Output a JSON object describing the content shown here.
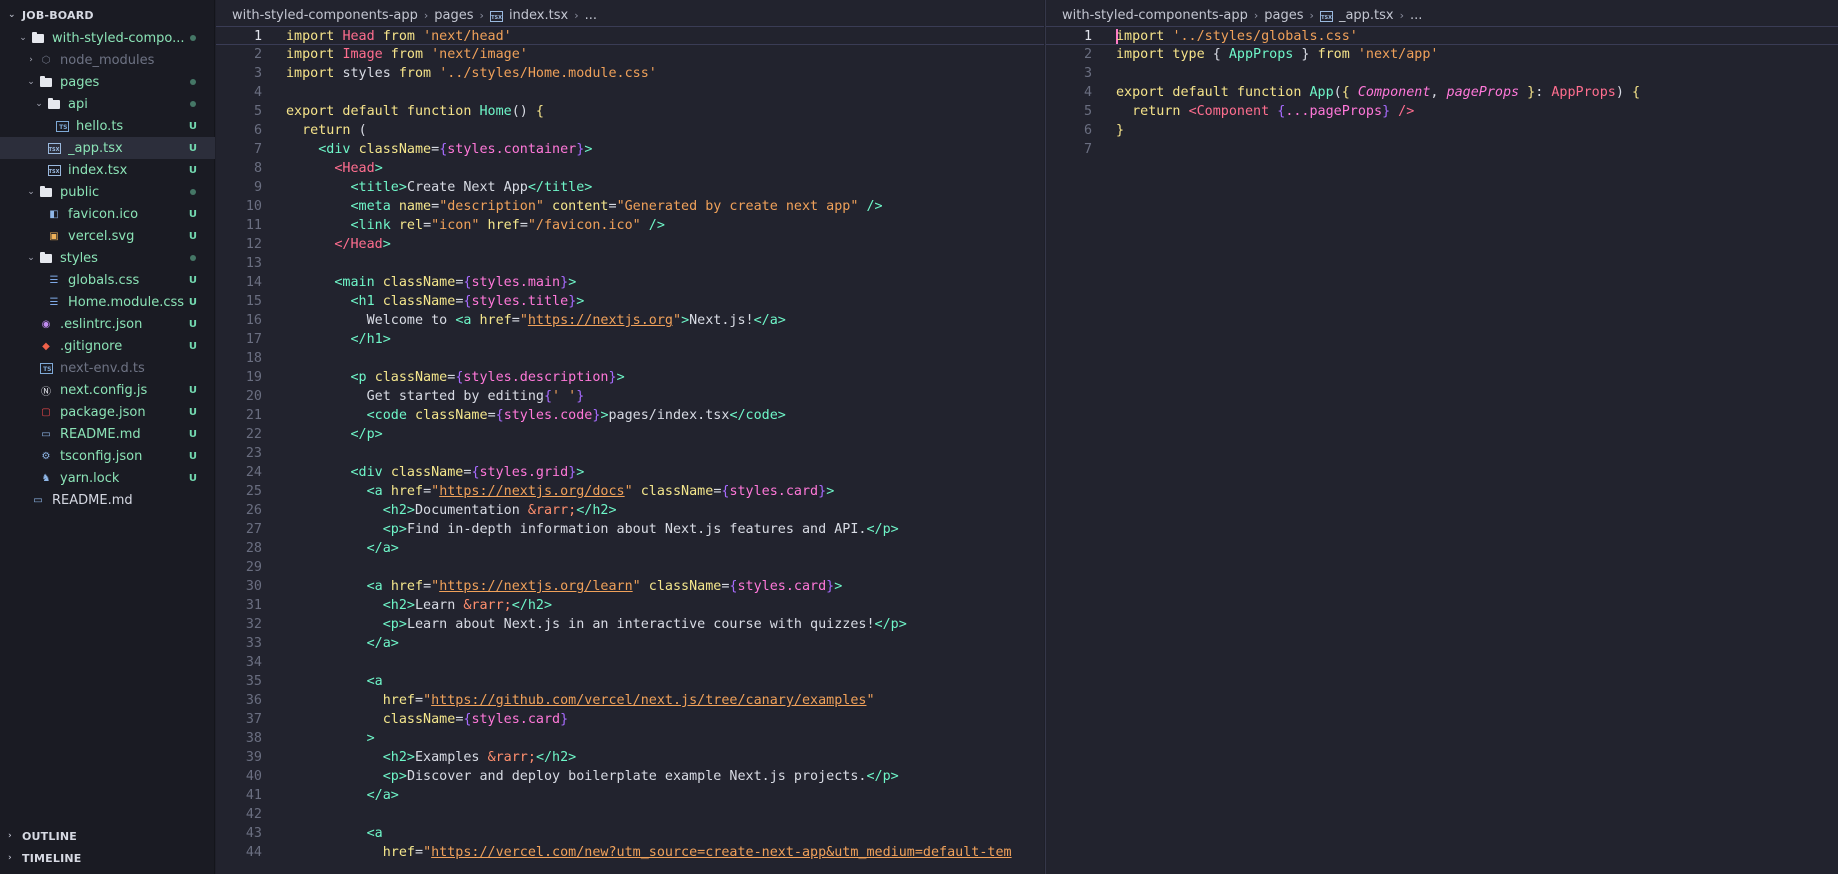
{
  "sidebar": {
    "root": "JOB-BOARD",
    "outline": "OUTLINE",
    "timeline": "TIMELINE",
    "items": [
      {
        "label": "with-styled-compo...",
        "depth": 1,
        "kind": "folder-open",
        "status": "dot",
        "color": "green"
      },
      {
        "label": "node_modules",
        "depth": 2,
        "kind": "folder-closed",
        "status": "",
        "dim": true,
        "icon": "node-icon"
      },
      {
        "label": "pages",
        "depth": 2,
        "kind": "folder-open",
        "status": "dot",
        "color": "green"
      },
      {
        "label": "api",
        "depth": 3,
        "kind": "folder-open",
        "status": "dot",
        "color": "green"
      },
      {
        "label": "hello.ts",
        "depth": 4,
        "kind": "file",
        "icon": "ts-icon",
        "status": "U",
        "color": "green"
      },
      {
        "label": "_app.tsx",
        "depth": 3,
        "kind": "file",
        "icon": "tsx-icon",
        "status": "U",
        "color": "green",
        "active": true
      },
      {
        "label": "index.tsx",
        "depth": 3,
        "kind": "file",
        "icon": "tsx-icon",
        "status": "U",
        "color": "green"
      },
      {
        "label": "public",
        "depth": 2,
        "kind": "folder-open",
        "status": "dot",
        "color": "green"
      },
      {
        "label": "favicon.ico",
        "depth": 3,
        "kind": "file",
        "icon": "favicon-icon",
        "status": "U",
        "color": "green"
      },
      {
        "label": "vercel.svg",
        "depth": 3,
        "kind": "file",
        "icon": "svg-icon",
        "status": "U",
        "color": "green"
      },
      {
        "label": "styles",
        "depth": 2,
        "kind": "folder-open",
        "status": "dot",
        "color": "green"
      },
      {
        "label": "globals.css",
        "depth": 3,
        "kind": "file",
        "icon": "css-icon",
        "status": "U",
        "color": "green"
      },
      {
        "label": "Home.module.css",
        "depth": 3,
        "kind": "file",
        "icon": "css-icon",
        "status": "U",
        "color": "green"
      },
      {
        "label": ".eslintrc.json",
        "depth": 2,
        "kind": "file",
        "icon": "eslint-icon",
        "status": "U",
        "color": "green"
      },
      {
        "label": ".gitignore",
        "depth": 2,
        "kind": "file",
        "icon": "git-icon",
        "status": "U",
        "color": "green"
      },
      {
        "label": "next-env.d.ts",
        "depth": 2,
        "kind": "file",
        "icon": "ts-icon",
        "status": "",
        "dim": true
      },
      {
        "label": "next.config.js",
        "depth": 2,
        "kind": "file",
        "icon": "next-icon",
        "status": "U",
        "color": "green"
      },
      {
        "label": "package.json",
        "depth": 2,
        "kind": "file",
        "icon": "npm-icon",
        "status": "U",
        "color": "green"
      },
      {
        "label": "README.md",
        "depth": 2,
        "kind": "file",
        "icon": "markdown-icon",
        "status": "U",
        "color": "green"
      },
      {
        "label": "tsconfig.json",
        "depth": 2,
        "kind": "file",
        "icon": "tsconfig-icon",
        "status": "U",
        "color": "green"
      },
      {
        "label": "yarn.lock",
        "depth": 2,
        "kind": "file",
        "icon": "yarn-icon",
        "status": "U",
        "color": "green"
      },
      {
        "label": "README.md",
        "depth": 1,
        "kind": "file",
        "icon": "markdown-icon",
        "status": ""
      }
    ]
  },
  "editor_left": {
    "breadcrumb": [
      "with-styled-components-app",
      "pages",
      "index.tsx",
      "..."
    ],
    "current_line": 1,
    "lines": [
      [
        [
          "k",
          "import "
        ],
        [
          "v",
          "Head"
        ],
        [
          "k",
          " from "
        ],
        [
          "s",
          "'next/head'"
        ]
      ],
      [
        [
          "k",
          "import "
        ],
        [
          "v",
          "Image"
        ],
        [
          "k",
          " from "
        ],
        [
          "s",
          "'next/image'"
        ]
      ],
      [
        [
          "k",
          "import "
        ],
        [
          "w",
          "styles"
        ],
        [
          "k",
          " from "
        ],
        [
          "s",
          "'../styles/Home.module.css'"
        ]
      ],
      [],
      [
        [
          "k",
          "export default function "
        ],
        [
          "f",
          "Home"
        ],
        [
          "w",
          "() "
        ],
        [
          "k",
          "{"
        ]
      ],
      [
        [
          "w",
          "  "
        ],
        [
          "k",
          "return "
        ],
        [
          "w",
          "("
        ]
      ],
      [
        [
          "w",
          "    "
        ],
        [
          "t",
          "<div "
        ],
        [
          "a",
          "className"
        ],
        [
          "w",
          "="
        ],
        [
          "b",
          "{"
        ],
        [
          "p",
          "styles.container"
        ],
        [
          "b",
          "}"
        ],
        [
          "t",
          ">"
        ]
      ],
      [
        [
          "w",
          "      "
        ],
        [
          "red",
          "<Head"
        ],
        [
          "t",
          ">"
        ]
      ],
      [
        [
          "w",
          "        "
        ],
        [
          "t",
          "<title>"
        ],
        [
          "w",
          "Create Next App"
        ],
        [
          "t",
          "</title>"
        ]
      ],
      [
        [
          "w",
          "        "
        ],
        [
          "t",
          "<meta "
        ],
        [
          "a",
          "name"
        ],
        [
          "w",
          "="
        ],
        [
          "s",
          "\"description\""
        ],
        [
          "a",
          " content"
        ],
        [
          "w",
          "="
        ],
        [
          "s",
          "\"Generated by create next app\""
        ],
        [
          "t",
          " />"
        ]
      ],
      [
        [
          "w",
          "        "
        ],
        [
          "t",
          "<link "
        ],
        [
          "a",
          "rel"
        ],
        [
          "w",
          "="
        ],
        [
          "s",
          "\"icon\""
        ],
        [
          "a",
          " href"
        ],
        [
          "w",
          "="
        ],
        [
          "s",
          "\"/favicon.ico\""
        ],
        [
          "t",
          " />"
        ]
      ],
      [
        [
          "w",
          "      "
        ],
        [
          "red",
          "</Head"
        ],
        [
          "t",
          ">"
        ]
      ],
      [],
      [
        [
          "w",
          "      "
        ],
        [
          "t",
          "<main "
        ],
        [
          "a",
          "className"
        ],
        [
          "w",
          "="
        ],
        [
          "b",
          "{"
        ],
        [
          "p",
          "styles.main"
        ],
        [
          "b",
          "}"
        ],
        [
          "t",
          ">"
        ]
      ],
      [
        [
          "w",
          "        "
        ],
        [
          "t",
          "<h1 "
        ],
        [
          "a",
          "className"
        ],
        [
          "w",
          "="
        ],
        [
          "b",
          "{"
        ],
        [
          "p",
          "styles.title"
        ],
        [
          "b",
          "}"
        ],
        [
          "t",
          ">"
        ]
      ],
      [
        [
          "w",
          "          Welcome to "
        ],
        [
          "t",
          "<a "
        ],
        [
          "a",
          "href"
        ],
        [
          "w",
          "="
        ],
        [
          "s",
          "\""
        ],
        [
          "u",
          "https://nextjs.org"
        ],
        [
          "s",
          "\""
        ],
        [
          "t",
          ">"
        ],
        [
          "w",
          "Next.js!"
        ],
        [
          "t",
          "</a>"
        ]
      ],
      [
        [
          "w",
          "        "
        ],
        [
          "t",
          "</h1>"
        ]
      ],
      [],
      [
        [
          "w",
          "        "
        ],
        [
          "t",
          "<p "
        ],
        [
          "a",
          "className"
        ],
        [
          "w",
          "="
        ],
        [
          "b",
          "{"
        ],
        [
          "p",
          "styles.description"
        ],
        [
          "b",
          "}"
        ],
        [
          "t",
          ">"
        ]
      ],
      [
        [
          "w",
          "          Get started by editing"
        ],
        [
          "b",
          "{"
        ],
        [
          "s",
          "' '"
        ],
        [
          "b",
          "}"
        ]
      ],
      [
        [
          "w",
          "          "
        ],
        [
          "t",
          "<code "
        ],
        [
          "a",
          "className"
        ],
        [
          "w",
          "="
        ],
        [
          "b",
          "{"
        ],
        [
          "p",
          "styles.code"
        ],
        [
          "b",
          "}"
        ],
        [
          "t",
          ">"
        ],
        [
          "w",
          "pages/index.tsx"
        ],
        [
          "t",
          "</code>"
        ]
      ],
      [
        [
          "w",
          "        "
        ],
        [
          "t",
          "</p>"
        ]
      ],
      [],
      [
        [
          "w",
          "        "
        ],
        [
          "t",
          "<div "
        ],
        [
          "a",
          "className"
        ],
        [
          "w",
          "="
        ],
        [
          "b",
          "{"
        ],
        [
          "p",
          "styles.grid"
        ],
        [
          "b",
          "}"
        ],
        [
          "t",
          ">"
        ]
      ],
      [
        [
          "w",
          "          "
        ],
        [
          "t",
          "<a "
        ],
        [
          "a",
          "href"
        ],
        [
          "w",
          "="
        ],
        [
          "s",
          "\""
        ],
        [
          "u",
          "https://nextjs.org/docs"
        ],
        [
          "s",
          "\""
        ],
        [
          "a",
          " className"
        ],
        [
          "w",
          "="
        ],
        [
          "b",
          "{"
        ],
        [
          "p",
          "styles.card"
        ],
        [
          "b",
          "}"
        ],
        [
          "t",
          ">"
        ]
      ],
      [
        [
          "w",
          "            "
        ],
        [
          "t",
          "<h2>"
        ],
        [
          "w",
          "Documentation "
        ],
        [
          "ent",
          "&rarr;"
        ],
        [
          "t",
          "</h2>"
        ]
      ],
      [
        [
          "w",
          "            "
        ],
        [
          "t",
          "<p>"
        ],
        [
          "w",
          "Find in-depth information about Next.js features and API."
        ],
        [
          "t",
          "</p>"
        ]
      ],
      [
        [
          "w",
          "          "
        ],
        [
          "t",
          "</a>"
        ]
      ],
      [],
      [
        [
          "w",
          "          "
        ],
        [
          "t",
          "<a "
        ],
        [
          "a",
          "href"
        ],
        [
          "w",
          "="
        ],
        [
          "s",
          "\""
        ],
        [
          "u",
          "https://nextjs.org/learn"
        ],
        [
          "s",
          "\""
        ],
        [
          "a",
          " className"
        ],
        [
          "w",
          "="
        ],
        [
          "b",
          "{"
        ],
        [
          "p",
          "styles.card"
        ],
        [
          "b",
          "}"
        ],
        [
          "t",
          ">"
        ]
      ],
      [
        [
          "w",
          "            "
        ],
        [
          "t",
          "<h2>"
        ],
        [
          "w",
          "Learn "
        ],
        [
          "ent",
          "&rarr;"
        ],
        [
          "t",
          "</h2>"
        ]
      ],
      [
        [
          "w",
          "            "
        ],
        [
          "t",
          "<p>"
        ],
        [
          "w",
          "Learn about Next.js in an interactive course with quizzes!"
        ],
        [
          "t",
          "</p>"
        ]
      ],
      [
        [
          "w",
          "          "
        ],
        [
          "t",
          "</a>"
        ]
      ],
      [],
      [
        [
          "w",
          "          "
        ],
        [
          "t",
          "<a"
        ]
      ],
      [
        [
          "w",
          "            "
        ],
        [
          "a",
          "href"
        ],
        [
          "w",
          "="
        ],
        [
          "s",
          "\""
        ],
        [
          "u",
          "https://github.com/vercel/next.js/tree/canary/examples"
        ],
        [
          "s",
          "\""
        ]
      ],
      [
        [
          "w",
          "            "
        ],
        [
          "a",
          "className"
        ],
        [
          "w",
          "="
        ],
        [
          "b",
          "{"
        ],
        [
          "p",
          "styles.card"
        ],
        [
          "b",
          "}"
        ]
      ],
      [
        [
          "w",
          "          "
        ],
        [
          "t",
          ">"
        ]
      ],
      [
        [
          "w",
          "            "
        ],
        [
          "t",
          "<h2>"
        ],
        [
          "w",
          "Examples "
        ],
        [
          "ent",
          "&rarr;"
        ],
        [
          "t",
          "</h2>"
        ]
      ],
      [
        [
          "w",
          "            "
        ],
        [
          "t",
          "<p>"
        ],
        [
          "w",
          "Discover and deploy boilerplate example Next.js projects."
        ],
        [
          "t",
          "</p>"
        ]
      ],
      [
        [
          "w",
          "          "
        ],
        [
          "t",
          "</a>"
        ]
      ],
      [],
      [
        [
          "w",
          "          "
        ],
        [
          "t",
          "<a"
        ]
      ],
      [
        [
          "w",
          "            "
        ],
        [
          "a",
          "href"
        ],
        [
          "w",
          "="
        ],
        [
          "s",
          "\""
        ],
        [
          "u",
          "https://vercel.com/new?utm_source=create-next-app&utm_medium=default-tem"
        ]
      ]
    ]
  },
  "editor_right": {
    "breadcrumb": [
      "with-styled-components-app",
      "pages",
      "_app.tsx",
      "..."
    ],
    "current_line": 1,
    "lines": [
      [
        [
          "k",
          "import "
        ],
        [
          "s",
          "'../styles/globals.css'"
        ]
      ],
      [
        [
          "k",
          "import type "
        ],
        [
          "w",
          "{ "
        ],
        [
          "f",
          "AppProps"
        ],
        [
          "w",
          " } "
        ],
        [
          "k",
          "from "
        ],
        [
          "s",
          "'next/app'"
        ]
      ],
      [],
      [
        [
          "k",
          "export default function "
        ],
        [
          "f",
          "App"
        ],
        [
          "w",
          "("
        ],
        [
          "k",
          "{ "
        ],
        [
          "i",
          "Component"
        ],
        [
          "w",
          ", "
        ],
        [
          "i",
          "pageProps"
        ],
        [
          "k",
          " }"
        ],
        [
          "w",
          ": "
        ],
        [
          "red",
          "AppProps"
        ],
        [
          "w",
          ") "
        ],
        [
          "k",
          "{"
        ]
      ],
      [
        [
          "w",
          "  "
        ],
        [
          "k",
          "return "
        ],
        [
          "red",
          "<Component "
        ],
        [
          "b",
          "{"
        ],
        [
          "p",
          "...pageProps"
        ],
        [
          "b",
          "}"
        ],
        [
          "red",
          " />"
        ]
      ],
      [
        [
          "k",
          "}"
        ]
      ],
      []
    ]
  },
  "colors": {
    "background": "#22232e",
    "sidebar": "#1a1b23",
    "accent_git": "#73d9b0",
    "keyword": "#f5e38a",
    "string": "#f0a15a",
    "tag": "#6ff7c9",
    "brace": "#a86bff",
    "prop": "#ff78d9"
  }
}
